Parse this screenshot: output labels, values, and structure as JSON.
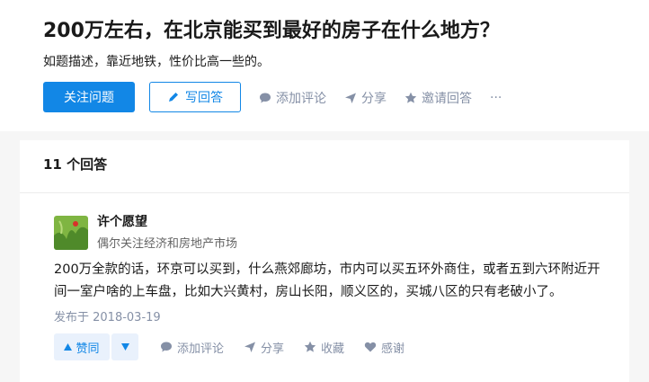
{
  "question": {
    "title": "200万左右，在北京能买到最好的房子在什么地方？",
    "detail": "如题描述，靠近地铁，性价比高一些的。",
    "follow_label": "关注问题",
    "write_label": "写回答",
    "actions": {
      "comment": "添加评论",
      "share": "分享",
      "invite": "邀请回答",
      "more": "···"
    }
  },
  "answers": {
    "count_label": "11 个回答",
    "items": [
      {
        "author": "许个愿望",
        "bio": "偶尔关注经济和房地产市场",
        "content": "200万全款的话，环京可以买到，什么燕郊廊坊，市内可以买五环外商住，或者五到六环附近开间一室户啥的上车盘，比如大兴黄村，房山长阳，顺义区的，买城八区的只有老破小了。",
        "date": "发布于 2018-03-19",
        "vote_up_label": "赞同",
        "actions": {
          "comment": "添加评论",
          "share": "分享",
          "collect": "收藏",
          "thanks": "感谢"
        }
      }
    ]
  },
  "colors": {
    "accent": "#1287e6",
    "muted": "#8590a6",
    "vote_bg": "#e9f1fc"
  },
  "icons": [
    "pencil-icon",
    "comment-icon",
    "share-icon",
    "star-icon",
    "more-icon",
    "triangle-up-icon",
    "triangle-down-icon",
    "heart-icon"
  ]
}
